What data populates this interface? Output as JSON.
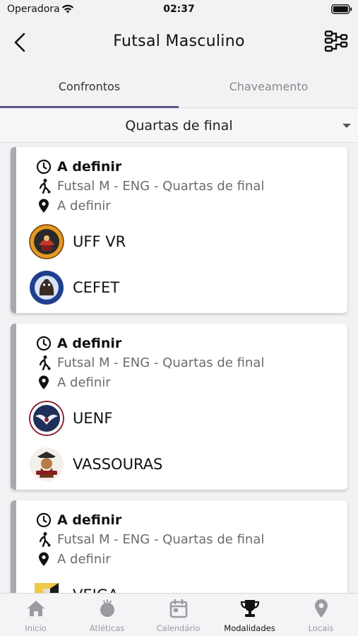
{
  "status_bar": {
    "carrier": "Operadora",
    "time": "02:37"
  },
  "header": {
    "title": "Futsal Masculino"
  },
  "tabs": [
    {
      "label": "Confrontos",
      "active": true
    },
    {
      "label": "Chaveamento",
      "active": false
    }
  ],
  "phase_select": {
    "selected": "Quartas de final"
  },
  "matches": [
    {
      "time": "A definir",
      "sport": "Futsal M - ENG - Quartas de final",
      "location": "A definir",
      "team_a": {
        "name": "UFF VR",
        "logo": "uff-vr-logo"
      },
      "team_b": {
        "name": "CEFET",
        "logo": "cefet-logo"
      }
    },
    {
      "time": "A definir",
      "sport": "Futsal M - ENG - Quartas de final",
      "location": "A definir",
      "team_a": {
        "name": "UENF",
        "logo": "uenf-logo"
      },
      "team_b": {
        "name": "VASSOURAS",
        "logo": "vassouras-logo"
      }
    },
    {
      "time": "A definir",
      "sport": "Futsal M - ENG - Quartas de final",
      "location": "A definir",
      "team_a": {
        "name": "VEIGA",
        "logo": "veiga-logo"
      },
      "team_b": {
        "name": "",
        "logo": ""
      }
    }
  ],
  "tab_bar": [
    {
      "label": "Início",
      "icon": "home-icon",
      "active": false
    },
    {
      "label": "Atléticas",
      "icon": "ball-icon",
      "active": false
    },
    {
      "label": "Calendário",
      "icon": "calendar-icon",
      "active": false
    },
    {
      "label": "Modalidades",
      "icon": "trophy-icon",
      "active": true
    },
    {
      "label": "Locais",
      "icon": "location-pin-icon",
      "active": false
    }
  ],
  "colors": {
    "accent": "#5b5a87",
    "card_border": "#a9a9ad",
    "inactive_tab": "#9a9aa0"
  }
}
